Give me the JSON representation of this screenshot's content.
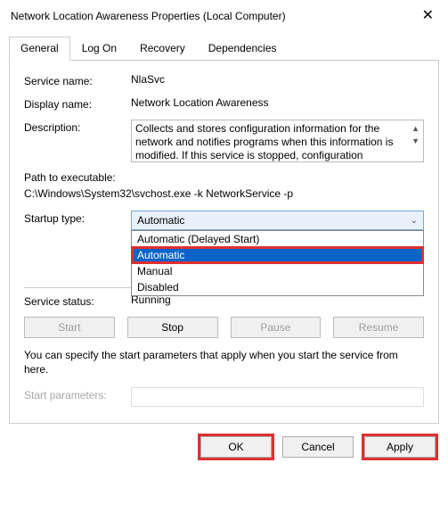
{
  "title": "Network Location Awareness Properties (Local Computer)",
  "tabs": [
    "General",
    "Log On",
    "Recovery",
    "Dependencies"
  ],
  "labels": {
    "service_name": "Service name:",
    "display_name": "Display name:",
    "description": "Description:",
    "path": "Path to executable:",
    "startup_type": "Startup type:",
    "service_status": "Service status:",
    "start_parameters": "Start parameters:"
  },
  "values": {
    "service_name": "NlaSvc",
    "display_name": "Network Location Awareness",
    "description": "Collects and stores configuration information for the network and notifies programs when this information is modified. If this service is stopped, configuration",
    "path": "C:\\Windows\\System32\\svchost.exe -k NetworkService -p",
    "startup_selected": "Automatic",
    "service_status": "Running"
  },
  "startup_options": [
    "Automatic (Delayed Start)",
    "Automatic",
    "Manual",
    "Disabled"
  ],
  "service_buttons": {
    "start": "Start",
    "stop": "Stop",
    "pause": "Pause",
    "resume": "Resume"
  },
  "hint": "You can specify the start parameters that apply when you start the service from here.",
  "dialog_buttons": {
    "ok": "OK",
    "cancel": "Cancel",
    "apply": "Apply"
  }
}
